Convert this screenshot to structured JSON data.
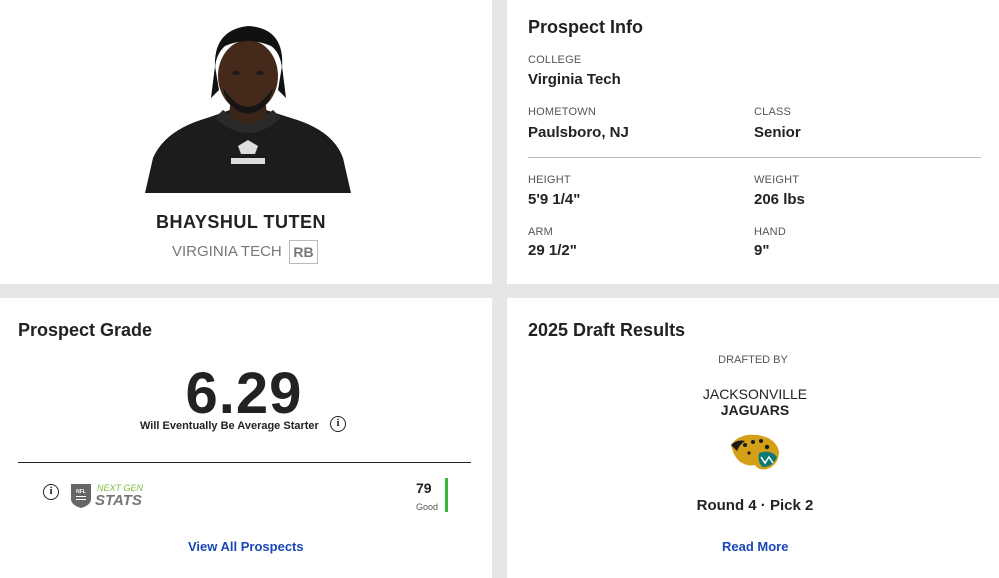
{
  "player": {
    "name": "BHAYSHUL TUTEN",
    "college": "VIRGINIA TECH",
    "position": "RB",
    "photo_icon": "player-headshot"
  },
  "prospect_info": {
    "title": "Prospect Info",
    "college_label": "COLLEGE",
    "college_value": "Virginia Tech",
    "hometown_label": "HOMETOWN",
    "hometown_value": "Paulsboro, NJ",
    "class_label": "CLASS",
    "class_value": "Senior",
    "height_label": "HEIGHT",
    "height_value": "5'9 1/4\"",
    "weight_label": "WEIGHT",
    "weight_value": "206 lbs",
    "arm_label": "ARM",
    "arm_value": "29 1/2\"",
    "hand_label": "HAND",
    "hand_value": "9\""
  },
  "grade": {
    "title": "Prospect Grade",
    "value": "6.29",
    "description": "Will Eventually Be Average Starter",
    "ngs_score": "79",
    "ngs_tier": "Good",
    "ngs_logo_text_top": "NEXT GEN",
    "ngs_logo_text_bottom": "STATS",
    "ngs_bar_color": "#3bb53b",
    "view_all_label": "View All Prospects"
  },
  "draft": {
    "title": "2025 Draft Results",
    "drafted_by_label": "DRAFTED BY",
    "team_city": "JACKSONVILLE",
    "team_name": "JAGUARS",
    "team_logo_icon": "jaguars-logo",
    "round_pick": "Round 4 · Pick 2",
    "read_more_label": "Read More"
  },
  "colors": {
    "link": "#1a47b8",
    "background": "#e6e6e6",
    "card": "#ffffff"
  }
}
